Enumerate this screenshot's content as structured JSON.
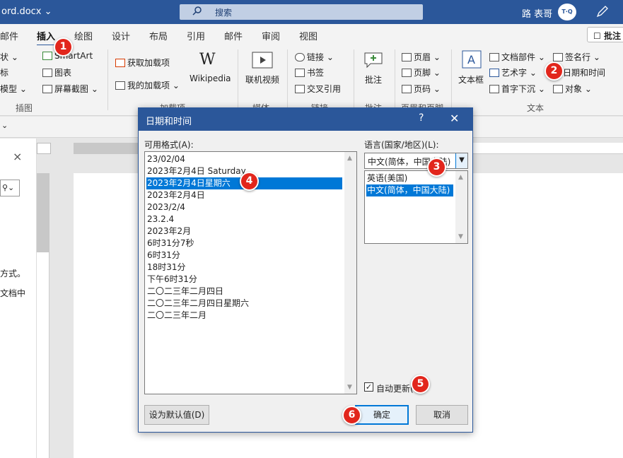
{
  "titlebar": {
    "doc_title": "ord.docx ⌄",
    "search_placeholder": "搜索",
    "user_name": "路 表哥",
    "avatar_text": "T·Q"
  },
  "tabs": [
    "邮件",
    "插入",
    "绘图",
    "设计",
    "布局",
    "引用",
    "邮件",
    "审阅",
    "视图"
  ],
  "comment_button": "批注",
  "ribbon": {
    "illustrations": {
      "partial_items": [
        "状 ⌄",
        "标",
        "模型 ⌄"
      ],
      "smartart": "SmartArt",
      "chart": "图表",
      "screenshot": "屏幕截图 ⌄",
      "group_label": "插图"
    },
    "addins": {
      "get_addins": "获取加载项",
      "my_addins": "我的加载项 ⌄",
      "wikipedia": "Wikipedia",
      "group_label": "加载项"
    },
    "media": {
      "online_video": "联机视频",
      "group_label": "媒体"
    },
    "links": {
      "link": "链接 ⌄",
      "bookmark": "书签",
      "cross_ref": "交叉引用",
      "group_label": "链接"
    },
    "comments": {
      "comment": "批注",
      "group_label": "批注"
    },
    "header_footer": {
      "header": "页眉 ⌄",
      "footer": "页脚 ⌄",
      "page_number": "页码 ⌄",
      "group_label": "页眉和页脚"
    },
    "text": {
      "textbox": "文本框",
      "quick_parts": "文档部件 ⌄",
      "wordart": "艺术字 ⌄",
      "dropcap": "首字下沉 ⌄",
      "signature": "签名行 ⌄",
      "datetime": "日期和时间",
      "object": "对象 ⌄",
      "group_label": "文本"
    }
  },
  "leftpane": {
    "close": "×",
    "text1": "方式。",
    "text2": "文档中"
  },
  "dialog": {
    "title": "日期和时间",
    "help": "?",
    "close": "✕",
    "formats_label": "可用格式(A):",
    "formats": [
      "23/02/04",
      "2023年2月4日 Saturday",
      "2023年2月4日星期六",
      "2023年2月4日",
      "2023/2/4",
      "23.2.4",
      "2023年2月",
      "6时31分7秒",
      "6时31分",
      "18时31分",
      "下午6时31分",
      "二〇二三年二月四日",
      "二〇二三年二月四日星期六",
      "二〇二三年二月"
    ],
    "selected_format_index": 2,
    "language_label": "语言(国家/地区)(L):",
    "language_selected": "中文(简体，中国大陆)",
    "languages": [
      "英语(美国)",
      "中文(简体，中国大陆)"
    ],
    "selected_language_index": 1,
    "auto_update_label": "自动更新(U)",
    "auto_update_checked": true,
    "set_default": "设为默认值(D)",
    "ok": "确定",
    "cancel": "取消"
  },
  "badges": [
    "1",
    "2",
    "3",
    "4",
    "5",
    "6"
  ],
  "colors": {
    "title_blue": "#2b579a",
    "selection": "#0078d7",
    "badge_red": "#e2261c"
  }
}
